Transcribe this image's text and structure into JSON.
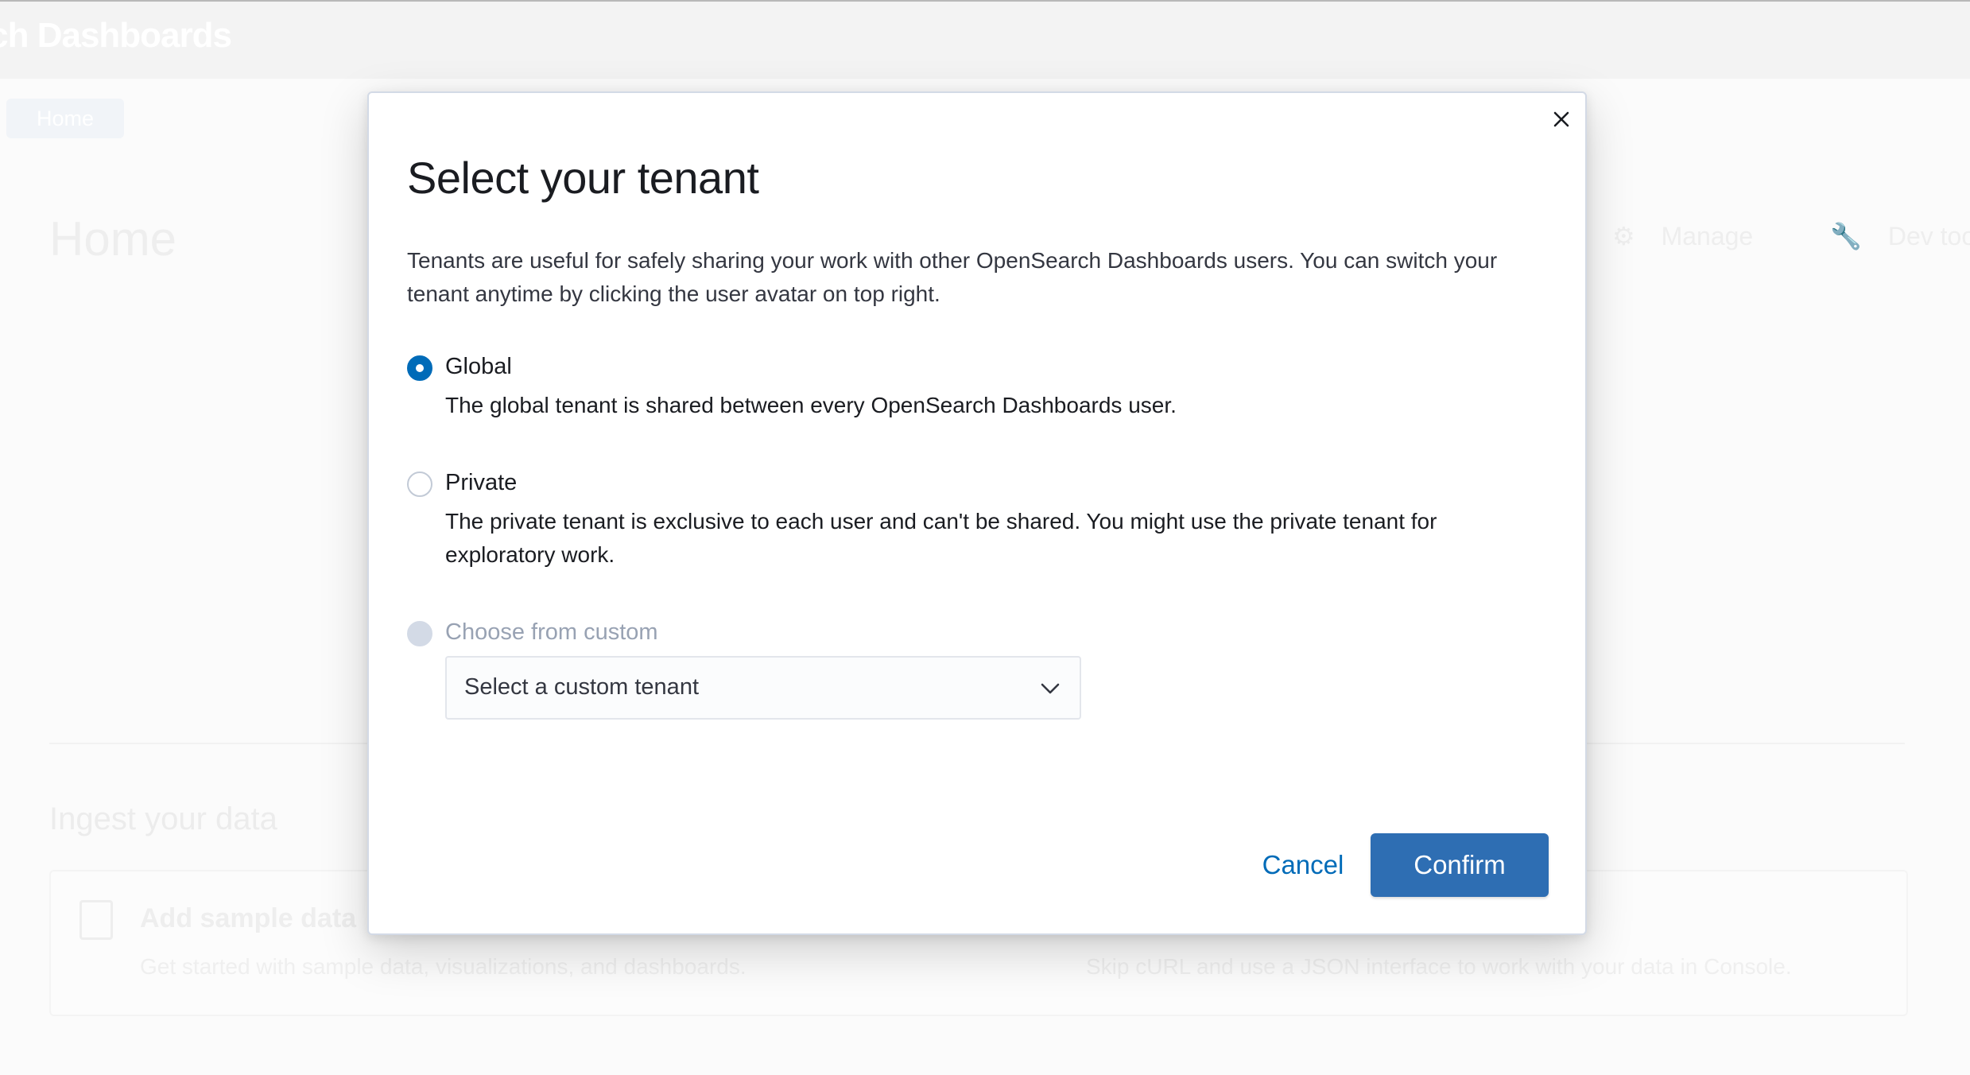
{
  "background": {
    "brand_text": "rch Dashboards",
    "breadcrumb": "Home",
    "page_title": "Home",
    "actions": [
      "Manage",
      "Dev tools"
    ],
    "section_title": "Ingest your data",
    "card": {
      "title": "Add sample data",
      "description": "Get started with sample data, visualizations, and dashboards."
    },
    "card2_description": "Skip cURL and use a JSON interface to work with your data in Console."
  },
  "modal": {
    "title": "Select your tenant",
    "description": "Tenants are useful for safely sharing your work with other OpenSearch Dashboards users. You can switch your tenant anytime by clicking the user avatar on top right.",
    "options": [
      {
        "label": "Global",
        "help": "The global tenant is shared between every OpenSearch Dashboards user.",
        "state": "checked"
      },
      {
        "label": "Private",
        "help": "The private tenant is exclusive to each user and can't be shared. You might use the private tenant for exploratory work.",
        "state": "unchecked"
      },
      {
        "label": "Choose from custom",
        "help": "",
        "state": "disabled"
      }
    ],
    "custom_select": {
      "value": "Select a custom tenant"
    },
    "buttons": {
      "cancel": "Cancel",
      "confirm": "Confirm"
    }
  },
  "colors": {
    "primary": "#006bb8",
    "confirm_bg": "#2e6eb3",
    "text": "#1a1c21",
    "muted": "#98a2b3"
  }
}
